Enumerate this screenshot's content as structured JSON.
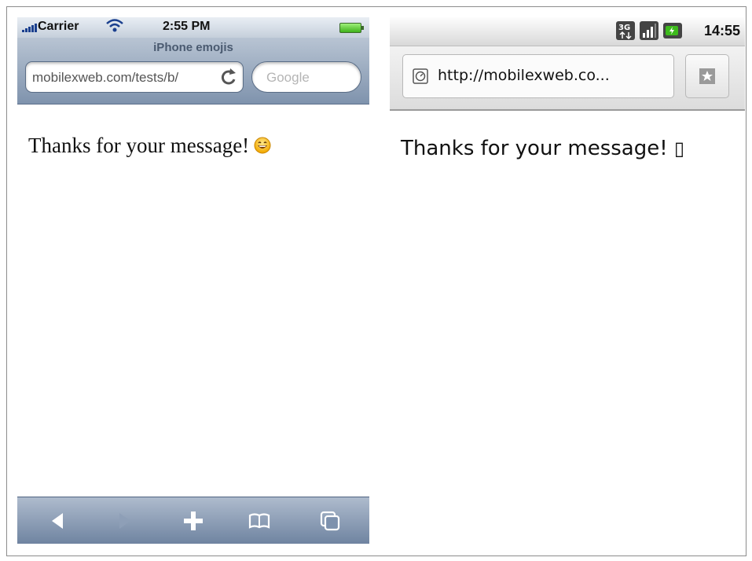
{
  "iphone": {
    "status": {
      "carrier": "Carrier",
      "time": "2:55 PM"
    },
    "title": "iPhone emojis",
    "url": "mobilexweb.com/tests/b/",
    "search_placeholder": "Google",
    "message": "Thanks for your message!",
    "emoji_icon": "smiling-face-emoji-icon",
    "toolbar": [
      "back-icon",
      "forward-icon",
      "add-icon",
      "bookmarks-icon",
      "pages-icon"
    ]
  },
  "android": {
    "status": {
      "time": "14:55",
      "network": "3G"
    },
    "url": "http://mobilexweb.co...",
    "message": "Thanks for your message!",
    "missing_glyph": "▯"
  }
}
